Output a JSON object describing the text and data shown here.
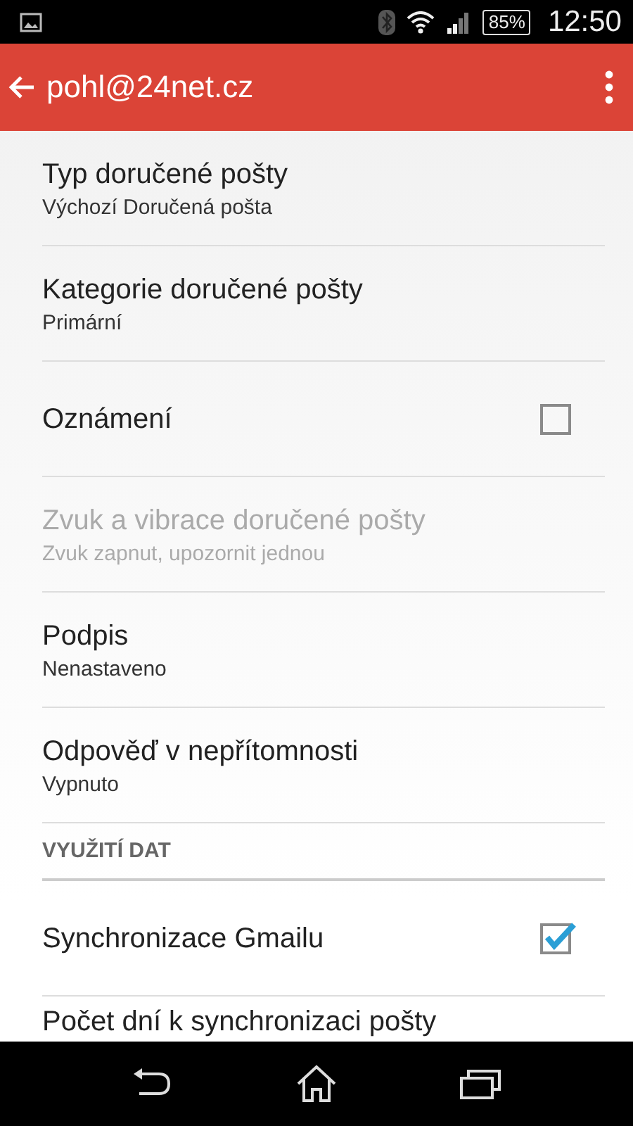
{
  "status_bar": {
    "battery": "85%",
    "time": "12:50"
  },
  "app_bar": {
    "title": "pohl@24net.cz"
  },
  "items": [
    {
      "kind": "setting",
      "title": "Typ doručené pošty",
      "subtitle": "Výchozí Doručená pošta",
      "disabled": false
    },
    {
      "kind": "setting",
      "title": "Kategorie doručené pošty",
      "subtitle": "Primární",
      "disabled": false
    },
    {
      "kind": "checkbox",
      "title": "Oznámení",
      "checked": false,
      "disabled": false
    },
    {
      "kind": "setting",
      "title": "Zvuk a vibrace doručené pošty",
      "subtitle": "Zvuk zapnut, upozornit jednou",
      "disabled": true
    },
    {
      "kind": "setting",
      "title": "Podpis",
      "subtitle": "Nenastaveno",
      "disabled": false
    },
    {
      "kind": "setting",
      "title": "Odpověď v nepřítomnosti",
      "subtitle": "Vypnuto",
      "disabled": false
    },
    {
      "kind": "header",
      "title": "VYUŽITÍ DAT"
    },
    {
      "kind": "checkbox",
      "title": "Synchronizace Gmailu",
      "checked": true,
      "disabled": false
    },
    {
      "kind": "setting",
      "title": "Počet dní k synchronizaci pošty",
      "disabled": false
    }
  ]
}
